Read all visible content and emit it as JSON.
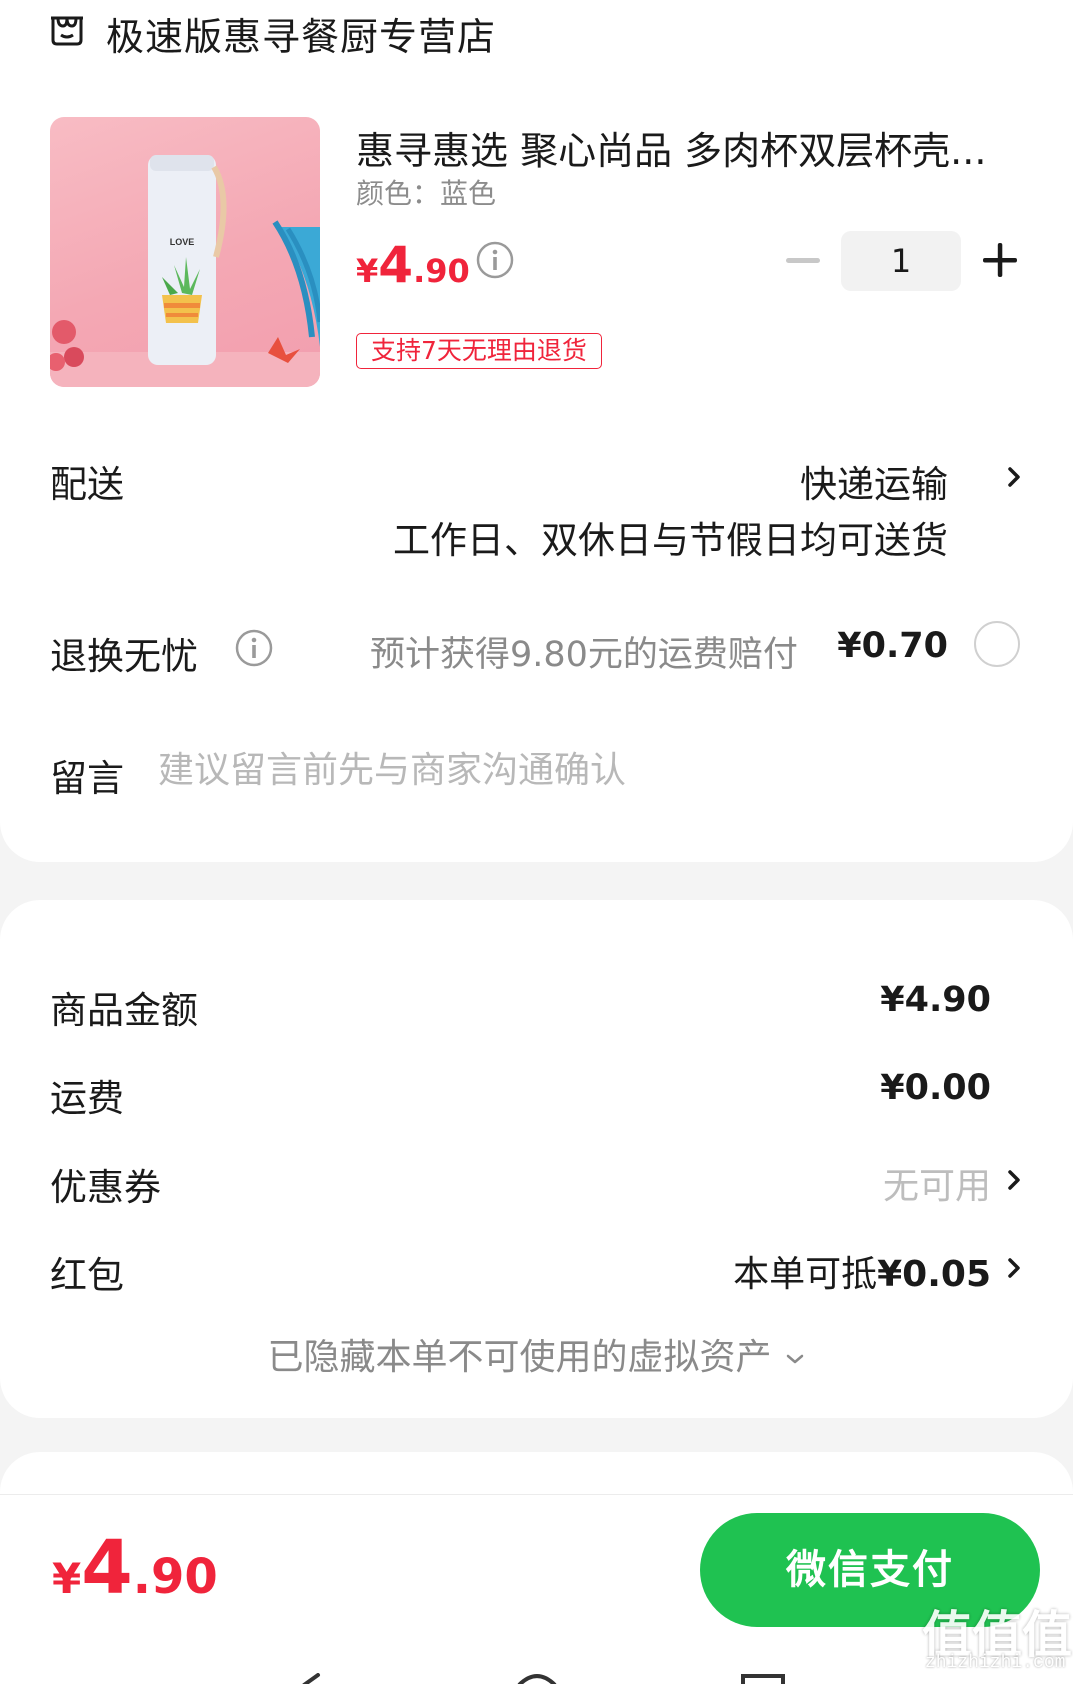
{
  "store": {
    "name": "极速版惠寻餐厨专营店",
    "icon": "store-icon"
  },
  "product": {
    "title": "惠寻惠选 聚心尚品 多肉杯双层杯壳...",
    "variant": "颜色：蓝色",
    "price_currency": "¥",
    "price_int": "4",
    "price_dec": ".90",
    "quantity": "1",
    "return_tag": "支持7天无理由退货",
    "image_text": "LOVE"
  },
  "delivery": {
    "label": "配送",
    "value": "快递运输",
    "note": "工作日、双休日与节假日均可送货"
  },
  "worry_free": {
    "label": "退换无忧",
    "desc": "预计获得9.80元的运费赔付",
    "price": "¥0.70",
    "selected": false
  },
  "message": {
    "label": "留言",
    "placeholder": "建议留言前先与商家沟通确认"
  },
  "summary": {
    "goods_label": "商品金额",
    "goods_value": "¥4.90",
    "shipping_label": "运费",
    "shipping_value": "¥0.00",
    "coupon_label": "优惠券",
    "coupon_value": "无可用",
    "redpack_label": "红包",
    "redpack_prefix": "本单可抵",
    "redpack_amount": "¥0.05",
    "hidden_assets": "已隐藏本单不可使用的虚拟资产"
  },
  "bottom": {
    "total_currency": "¥",
    "total_int": "4",
    "total_dec": ".90",
    "pay_label": "微信支付",
    "watermark": "值值值",
    "watermark_sub": "zhizhizhi.com"
  },
  "colors": {
    "accent_red": "#f0243b",
    "pay_green": "#1fc251",
    "muted_gray": "#8a8a8a"
  }
}
